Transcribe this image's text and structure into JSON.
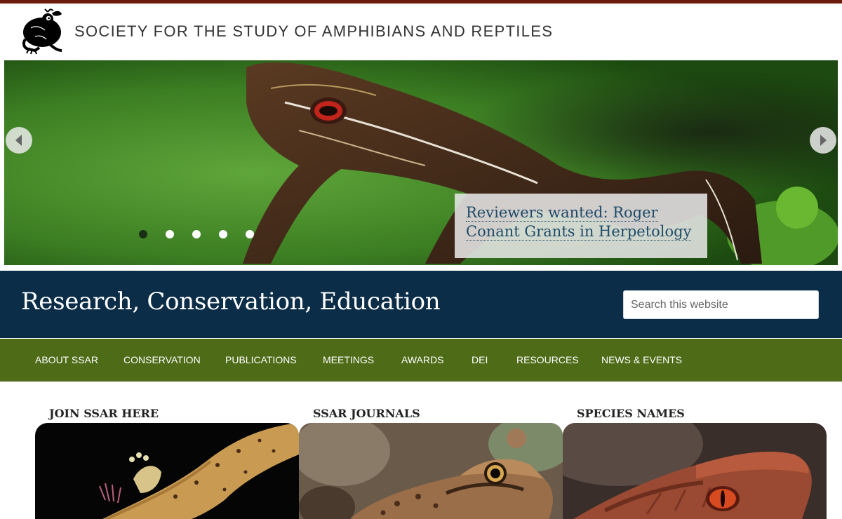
{
  "header": {
    "site_title": "SOCIETY FOR THE STUDY OF AMPHIBIANS AND REPTILES",
    "logo_icon": "frog-logo-icon",
    "accent_color": "#6b1a0c"
  },
  "slider": {
    "caption": "Reviewers wanted: Roger Conant Grants in Herpetology",
    "prev_icon": "chevron-left-icon",
    "next_icon": "chevron-right-icon",
    "slide_count": 5,
    "active_slide": 1
  },
  "band": {
    "tagline": "Research, Conservation, Education",
    "search_placeholder": "Search this website",
    "color": "#0c2d48"
  },
  "nav": {
    "color": "#4e6b18",
    "items": [
      "ABOUT SSAR",
      "CONSERVATION",
      "PUBLICATIONS",
      "MEETINGS",
      "AWARDS",
      "DEI",
      "RESOURCES",
      "NEWS & EVENTS"
    ]
  },
  "features": [
    {
      "title": "JOIN SSAR HERE",
      "image": "salamander-photo"
    },
    {
      "title": "SSAR JOURNALS",
      "image": "frog-photo"
    },
    {
      "title": "SPECIES NAMES",
      "image": "snake-photo"
    }
  ]
}
